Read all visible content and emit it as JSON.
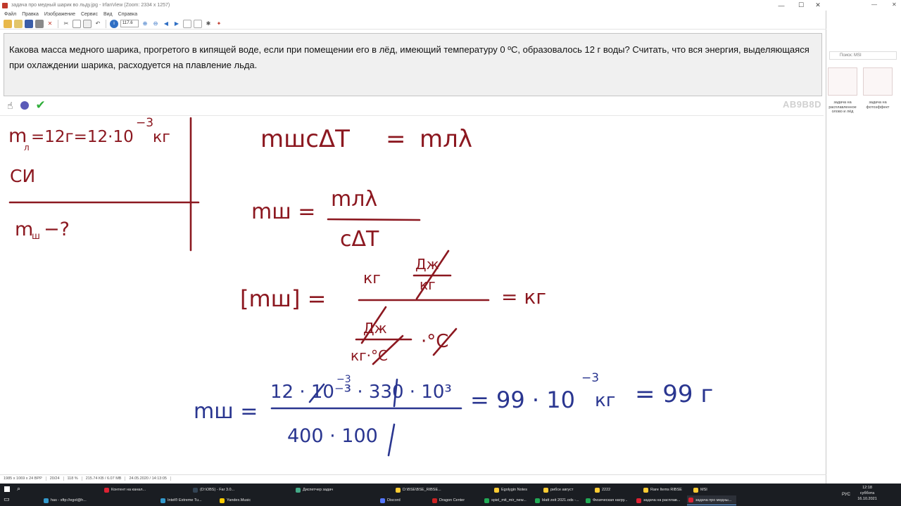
{
  "window": {
    "title": "задача про медный шарик во льду.jpg - IrfanView (Zoom: 2334 x 1257)",
    "minimize": "—",
    "maximize": "☐",
    "close": "✕"
  },
  "menu": [
    "Файл",
    "Правка",
    "Изображение",
    "Сервис",
    "Вид",
    "Справка"
  ],
  "toolbar": {
    "zoom_value": "117.6"
  },
  "task": {
    "text": "Какова масса медного шарика, прогретого в кипящей воде, если при помещении его в лёд, имеющий температуру 0 ºС, образовалось 12 г воды? Считать, что вся энергия, выделяющаяся при охлаждении шарика,  расходуется на плавление льда."
  },
  "board": {
    "watermark": "AB9B8D",
    "given": {
      "line1_left": "m",
      "line1_sub": "л",
      "line1_rest": "=12г=12·10",
      "line1_exp": "−3",
      "line1_unit": "кг",
      "line2": "СИ",
      "find": "m",
      "find_sub": "ш",
      "find_rest": "−?"
    },
    "eq1": {
      "left": "mшcΔT",
      "right": "mлλ"
    },
    "eq2": {
      "lhs": "mш =",
      "num": "mлλ",
      "den": "cΔT"
    },
    "eq3": {
      "lhs": "[mш] =",
      "num_left": "кг",
      "num_frac_top": "Дж",
      "num_frac_bot": "кг",
      "den_top": "Дж",
      "den_bot": "кг·°С",
      "den_right": "·°С",
      "result": "= кг"
    },
    "eq4": {
      "lhs": "mш =",
      "num": "12 · 10⁻³ · 330 · 10³",
      "den": "400 · 100",
      "result": "= 99 · 10",
      "result_exp": "−3",
      "result_unit": "кг",
      "final": "= 99 г"
    }
  },
  "statusbar": [
    "1985 x 1069 x 24 BPP",
    "20/24",
    "118 %",
    "215.74 KB / 6.07 MB",
    "24.05.2020 / 14:13:05"
  ],
  "explorer": {
    "search_placeholder": "Поиск: MSI",
    "items": [
      "задача на расплавленное олово и лёд",
      "задача на фотоэффект"
    ]
  },
  "taskbar": {
    "row1": [
      "Контент на канал...",
      "(D:\\OBS) - Far 3.0...",
      "Диспетчер задач",
      "D:\\BSE\\BSE_RIBSE...",
      "Egolygin Notes",
      "рибсе август",
      "2222",
      "Rare Items RIBSE",
      "MSI"
    ],
    "row2": [
      "has - sftp://egol@h...",
      "Intel® Extreme Tu...",
      "Yandex.Music",
      "Discord",
      "Dragon Center",
      "spiel_mit_mir_new...",
      "blatt zeit 2021.ods -...",
      "Физическая нагру...",
      "задача на расплав...",
      "задача про медны..."
    ],
    "lang": "РУС",
    "time": "12:18",
    "day": "суббота",
    "date": "16.10.2021"
  }
}
